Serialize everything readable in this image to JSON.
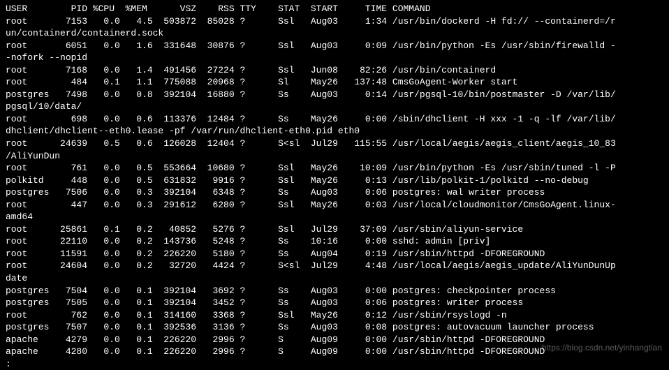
{
  "watermark": "https://blog.csdn.net/yinhangtian",
  "header": {
    "user": "USER",
    "pid": "PID",
    "cpu": "%CPU",
    "mem": "%MEM",
    "vsz": "VSZ",
    "rss": "RSS",
    "tty": "TTY",
    "stat": "STAT",
    "start": "START",
    "time": "TIME",
    "command": "COMMAND"
  },
  "rows": [
    {
      "user": "root",
      "pid": "7153",
      "cpu": "0.0",
      "mem": "4.5",
      "vsz": "503872",
      "rss": "85028",
      "tty": "?",
      "stat": "Ssl",
      "start": "Aug03",
      "time": "1:34",
      "command": "/usr/bin/dockerd -H fd:// --containerd=/r",
      "wrap": "un/containerd/containerd.sock"
    },
    {
      "user": "root",
      "pid": "6051",
      "cpu": "0.0",
      "mem": "1.6",
      "vsz": "331648",
      "rss": "30876",
      "tty": "?",
      "stat": "Ssl",
      "start": "Aug03",
      "time": "0:09",
      "command": "/usr/bin/python -Es /usr/sbin/firewalld -",
      "wrap": "-nofork --nopid"
    },
    {
      "user": "root",
      "pid": "7168",
      "cpu": "0.0",
      "mem": "1.4",
      "vsz": "491456",
      "rss": "27224",
      "tty": "?",
      "stat": "Ssl",
      "start": "Jun08",
      "time": "82:26",
      "command": "/usr/bin/containerd"
    },
    {
      "user": "root",
      "pid": "484",
      "cpu": "0.1",
      "mem": "1.1",
      "vsz": "775088",
      "rss": "20968",
      "tty": "?",
      "stat": "Sl",
      "start": "May26",
      "time": "137:48",
      "command": "CmsGoAgent-Worker start"
    },
    {
      "user": "postgres",
      "pid": "7498",
      "cpu": "0.0",
      "mem": "0.8",
      "vsz": "392104",
      "rss": "16880",
      "tty": "?",
      "stat": "Ss",
      "start": "Aug03",
      "time": "0:14",
      "command": "/usr/pgsql-10/bin/postmaster -D /var/lib/",
      "wrap": "pgsql/10/data/"
    },
    {
      "user": "root",
      "pid": "698",
      "cpu": "0.0",
      "mem": "0.6",
      "vsz": "113376",
      "rss": "12484",
      "tty": "?",
      "stat": "Ss",
      "start": "May26",
      "time": "0:00",
      "command": "/sbin/dhclient -H xxx -1 -q -lf /var/lib/",
      "wrap": "dhclient/dhclient--eth0.lease -pf /var/run/dhclient-eth0.pid eth0"
    },
    {
      "user": "root",
      "pid": "24639",
      "cpu": "0.5",
      "mem": "0.6",
      "vsz": "126028",
      "rss": "12404",
      "tty": "?",
      "stat": "S<sl",
      "start": "Jul29",
      "time": "115:55",
      "command": "/usr/local/aegis/aegis_client/aegis_10_83",
      "wrap": "/AliYunDun"
    },
    {
      "user": "root",
      "pid": "761",
      "cpu": "0.0",
      "mem": "0.5",
      "vsz": "553664",
      "rss": "10680",
      "tty": "?",
      "stat": "Ssl",
      "start": "May26",
      "time": "10:09",
      "command": "/usr/bin/python -Es /usr/sbin/tuned -l -P"
    },
    {
      "user": "polkitd",
      "pid": "448",
      "cpu": "0.0",
      "mem": "0.5",
      "vsz": "631832",
      "rss": "9916",
      "tty": "?",
      "stat": "Ssl",
      "start": "May26",
      "time": "0:13",
      "command": "/usr/lib/polkit-1/polkitd --no-debug"
    },
    {
      "user": "postgres",
      "pid": "7506",
      "cpu": "0.0",
      "mem": "0.3",
      "vsz": "392104",
      "rss": "6348",
      "tty": "?",
      "stat": "Ss",
      "start": "Aug03",
      "time": "0:06",
      "command": "postgres: wal writer process"
    },
    {
      "user": "root",
      "pid": "447",
      "cpu": "0.0",
      "mem": "0.3",
      "vsz": "291612",
      "rss": "6280",
      "tty": "?",
      "stat": "Ssl",
      "start": "May26",
      "time": "0:03",
      "command": "/usr/local/cloudmonitor/CmsGoAgent.linux-",
      "wrap": "amd64"
    },
    {
      "user": "root",
      "pid": "25861",
      "cpu": "0.1",
      "mem": "0.2",
      "vsz": "40852",
      "rss": "5276",
      "tty": "?",
      "stat": "Ssl",
      "start": "Jul29",
      "time": "37:09",
      "command": "/usr/sbin/aliyun-service"
    },
    {
      "user": "root",
      "pid": "22110",
      "cpu": "0.0",
      "mem": "0.2",
      "vsz": "143736",
      "rss": "5248",
      "tty": "?",
      "stat": "Ss",
      "start": "10:16",
      "time": "0:00",
      "command": "sshd: admin [priv]"
    },
    {
      "user": "root",
      "pid": "11591",
      "cpu": "0.0",
      "mem": "0.2",
      "vsz": "226220",
      "rss": "5180",
      "tty": "?",
      "stat": "Ss",
      "start": "Aug04",
      "time": "0:19",
      "command": "/usr/sbin/httpd -DFOREGROUND"
    },
    {
      "user": "root",
      "pid": "24604",
      "cpu": "0.0",
      "mem": "0.2",
      "vsz": "32720",
      "rss": "4424",
      "tty": "?",
      "stat": "S<sl",
      "start": "Jul29",
      "time": "4:48",
      "command": "/usr/local/aegis/aegis_update/AliYunDunUp",
      "wrap": "date"
    },
    {
      "user": "postgres",
      "pid": "7504",
      "cpu": "0.0",
      "mem": "0.1",
      "vsz": "392104",
      "rss": "3692",
      "tty": "?",
      "stat": "Ss",
      "start": "Aug03",
      "time": "0:00",
      "command": "postgres: checkpointer process"
    },
    {
      "user": "postgres",
      "pid": "7505",
      "cpu": "0.0",
      "mem": "0.1",
      "vsz": "392104",
      "rss": "3452",
      "tty": "?",
      "stat": "Ss",
      "start": "Aug03",
      "time": "0:06",
      "command": "postgres: writer process"
    },
    {
      "user": "root",
      "pid": "762",
      "cpu": "0.0",
      "mem": "0.1",
      "vsz": "314160",
      "rss": "3368",
      "tty": "?",
      "stat": "Ssl",
      "start": "May26",
      "time": "0:12",
      "command": "/usr/sbin/rsyslogd -n"
    },
    {
      "user": "postgres",
      "pid": "7507",
      "cpu": "0.0",
      "mem": "0.1",
      "vsz": "392536",
      "rss": "3136",
      "tty": "?",
      "stat": "Ss",
      "start": "Aug03",
      "time": "0:08",
      "command": "postgres: autovacuum launcher process"
    },
    {
      "user": "apache",
      "pid": "4279",
      "cpu": "0.0",
      "mem": "0.1",
      "vsz": "226220",
      "rss": "2996",
      "tty": "?",
      "stat": "S",
      "start": "Aug09",
      "time": "0:00",
      "command": "/usr/sbin/httpd -DFOREGROUND"
    },
    {
      "user": "apache",
      "pid": "4280",
      "cpu": "0.0",
      "mem": "0.1",
      "vsz": "226220",
      "rss": "2996",
      "tty": "?",
      "stat": "S",
      "start": "Aug09",
      "time": "0:00",
      "command": "/usr/sbin/httpd -DFOREGROUND"
    }
  ],
  "prompt": ":"
}
